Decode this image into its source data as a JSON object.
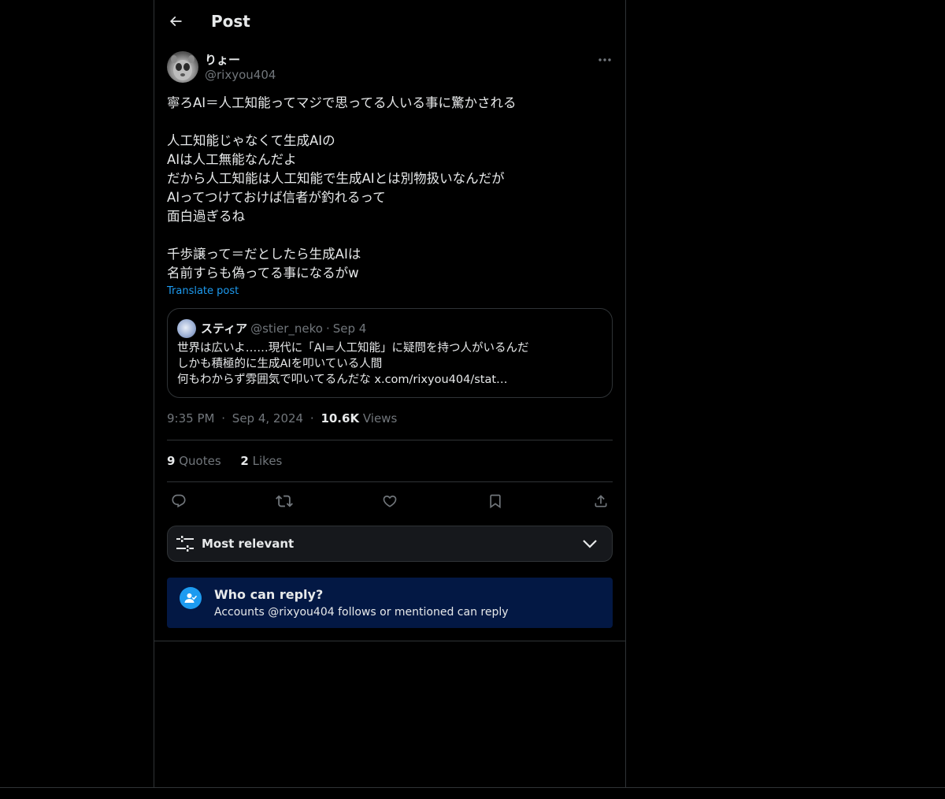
{
  "header": {
    "title": "Post"
  },
  "post": {
    "author": {
      "name": "りょー",
      "handle": "@rixyou404"
    },
    "text_lines": [
      "寧ろAI＝人工知能ってマジで思ってる人いる事に驚かされる",
      "",
      "人工知能じゃなくて生成AIの",
      "AIは人工無能なんだよ",
      "だから人工知能は人工知能で生成AIとは別物扱いなんだが",
      "AIってつけておけば信者が釣れるって",
      "面白過ぎるね",
      "",
      "千歩譲って＝だとしたら生成AIは",
      "名前すらも偽ってる事になるがw"
    ],
    "translate_label": "Translate post",
    "quote": {
      "name": "スティア",
      "handle": "@stier_neko",
      "separator": "·",
      "date": "Sep 4",
      "text_lines": [
        "世界は広いよ……現代に「AI=人工知能」に疑問を持つ人がいるんだ",
        "しかも積極的に生成AIを叩いている人間",
        "何もわからず雰囲気で叩いてるんだな x.com/rixyou404/stat…"
      ]
    },
    "meta": {
      "time": "9:35 PM",
      "separator": "·",
      "date": "Sep 4, 2024",
      "views_count": "10.6K",
      "views_label": "Views"
    },
    "stats": {
      "quotes_count": "9",
      "quotes_label": "Quotes",
      "likes_count": "2",
      "likes_label": "Likes"
    }
  },
  "actions": {
    "icons": [
      "reply-icon",
      "repost-icon",
      "like-icon",
      "bookmark-icon",
      "share-icon"
    ]
  },
  "sort": {
    "label": "Most relevant"
  },
  "reply_restriction": {
    "title": "Who can reply?",
    "subtitle": "Accounts @rixyou404 follows or mentioned can reply"
  },
  "colors": {
    "background": "#000000",
    "text": "#e7e9ea",
    "muted": "#71767b",
    "accent": "#1d9bf0",
    "border": "#2f3336",
    "reply_card_bg": "#031844"
  }
}
